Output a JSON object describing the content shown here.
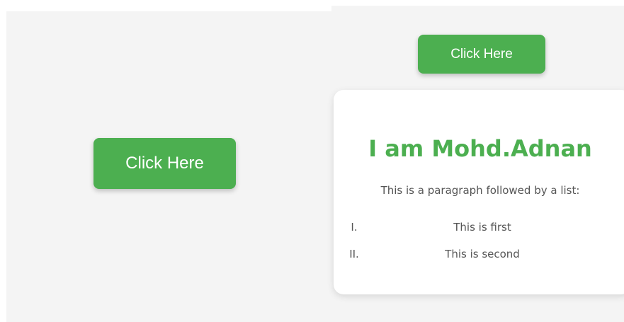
{
  "left_panel": {
    "button_label": "Click Here"
  },
  "right_panel": {
    "button_label": "Click Here",
    "card": {
      "title": "I am Mohd.Adnan",
      "paragraph": "This is a paragraph followed by a list:",
      "list": [
        {
          "marker": "I.",
          "text": "This is first"
        },
        {
          "marker": "II.",
          "text": "This is second"
        }
      ]
    }
  },
  "colors": {
    "accent": "#4caf50",
    "panel_background": "#f4f4f4",
    "card_background": "#ffffff",
    "text": "#555555"
  }
}
